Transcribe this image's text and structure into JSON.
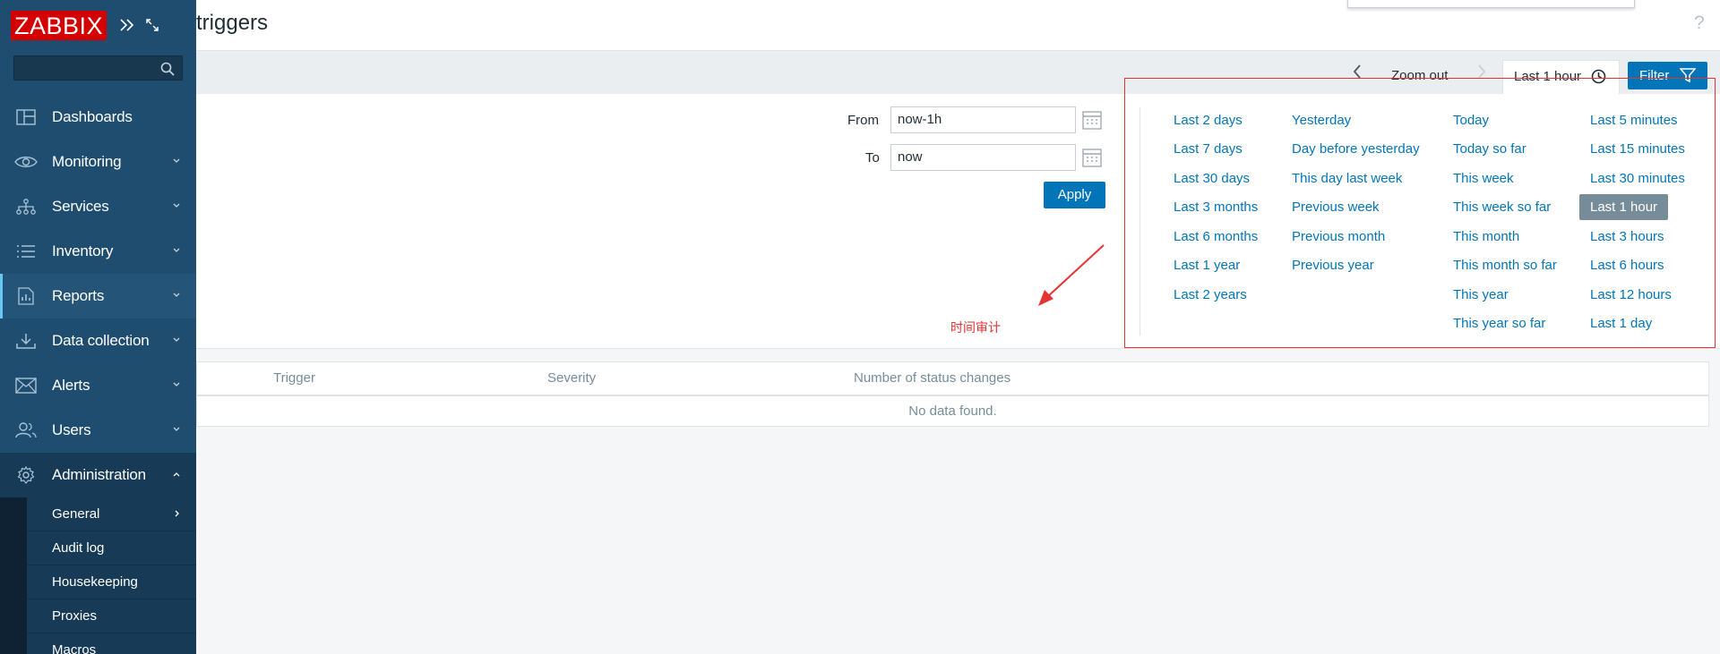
{
  "app": {
    "logo": "ZABBIX",
    "colors": {
      "brand_red": "#d40000",
      "sidebar": "#1f4d6f",
      "accent_blue": "#0275b8",
      "annotation_red": "#e53333"
    }
  },
  "header": {
    "title": "triggers",
    "help": "?"
  },
  "sidebar": {
    "search_placeholder": "",
    "items": [
      {
        "label": "Dashboards",
        "icon": "dashboard-icon"
      },
      {
        "label": "Monitoring",
        "icon": "eye-icon"
      },
      {
        "label": "Services",
        "icon": "sitemap-icon"
      },
      {
        "label": "Inventory",
        "icon": "list-icon"
      },
      {
        "label": "Reports",
        "icon": "report-icon"
      },
      {
        "label": "Data collection",
        "icon": "download-icon"
      },
      {
        "label": "Alerts",
        "icon": "envelope-icon"
      },
      {
        "label": "Users",
        "icon": "users-icon"
      },
      {
        "label": "Administration",
        "icon": "gear-icon"
      }
    ],
    "admin_subitems": [
      {
        "label": "General"
      },
      {
        "label": "Audit log"
      },
      {
        "label": "Housekeeping"
      },
      {
        "label": "Proxies"
      },
      {
        "label": "Macros"
      }
    ]
  },
  "filter_bar": {
    "zoom_out": "Zoom out",
    "period": "Last 1 hour",
    "filter": "Filter"
  },
  "time_filter": {
    "from_label": "From",
    "from_value": "now-1h",
    "to_label": "To",
    "to_value": "now",
    "apply": "Apply"
  },
  "quick_ranges": {
    "col1": [
      "Last 2 days",
      "Last 7 days",
      "Last 30 days",
      "Last 3 months",
      "Last 6 months",
      "Last 1 year",
      "Last 2 years"
    ],
    "col2": [
      "Yesterday",
      "Day before yesterday",
      "This day last week",
      "Previous week",
      "Previous month",
      "Previous year"
    ],
    "col3": [
      "Today",
      "Today so far",
      "This week",
      "This week so far",
      "This month",
      "This month so far",
      "This year",
      "This year so far"
    ],
    "col4": [
      "Last 5 minutes",
      "Last 15 minutes",
      "Last 30 minutes",
      "Last 1 hour",
      "Last 3 hours",
      "Last 6 hours",
      "Last 12 hours",
      "Last 1 day"
    ],
    "selected": "Last 1 hour"
  },
  "annotation": {
    "text": "时间审计"
  },
  "table": {
    "columns": [
      "Trigger",
      "Severity",
      "Number of status changes"
    ],
    "empty": "No data found."
  }
}
